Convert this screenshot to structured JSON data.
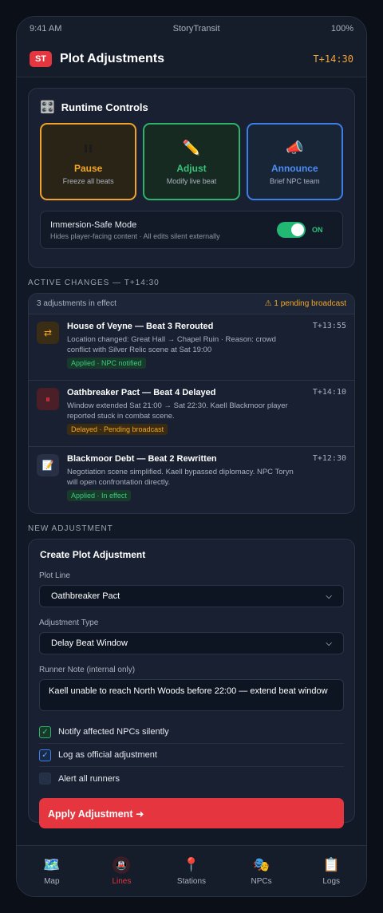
{
  "status": {
    "time": "9:41 AM",
    "carrier": "StoryTransit",
    "battery": "100%"
  },
  "app": {
    "logo": "ST",
    "title": "Plot Adjustments",
    "clock": "T+14:30"
  },
  "runtime": {
    "title": "Runtime Controls",
    "icon": "🎛️",
    "controls": [
      {
        "label": "Pause",
        "sub": "Freeze all beats",
        "color": "#f5a623"
      },
      {
        "label": "Adjust",
        "sub": "Modify live beat",
        "icon": "✏️",
        "color": "#39c27a"
      },
      {
        "label": "Announce",
        "sub": "Brief NPC team",
        "icon": "📣",
        "color": "#4d8ef5"
      }
    ],
    "immersion": {
      "title": "Immersion-Safe Mode",
      "sub": "Hides player-facing content · All edits silent externally",
      "state": "ON",
      "enabled": true
    }
  },
  "active": {
    "section_label": "ACTIVE CHANGES — T+14:30",
    "summary": "3 adjustments in effect",
    "pending": "⚠ 1 pending broadcast",
    "items": [
      {
        "icon": "⇄",
        "title": "House of Veyne — Beat 3 Rerouted",
        "time": "T+13:55",
        "desc": "Location changed: Great Hall → Chapel Ruin · Reason: crowd conflict with Silver Relic scene at Sat 19:00",
        "badge": "Applied · NPC notified"
      },
      {
        "icon": "⏸",
        "title": "Oathbreaker Pact — Beat 4 Delayed",
        "time": "T+14:10",
        "desc": "Window extended Sat 21:00 → Sat 22:30. Kaell Blackmoor player reported stuck in combat scene.",
        "badge": "Delayed · Pending broadcast"
      },
      {
        "icon": "📝",
        "title": "Blackmoor Debt — Beat 2 Rewritten",
        "time": "T+12:30",
        "desc": "Negotiation scene simplified. Kaell bypassed diplomacy. NPC Toryn will open confrontation directly.",
        "badge": "Applied · In effect"
      }
    ]
  },
  "form": {
    "section_label": "NEW ADJUSTMENT",
    "title": "Create Plot Adjustment",
    "plot_line_label": "Plot Line",
    "plot_line_value": "Oathbreaker Pact",
    "type_label": "Adjustment Type",
    "type_value": "Delay Beat Window",
    "note_label": "Runner Note (internal only)",
    "note_value": "Kaell unable to reach North Woods before 22:00 — extend beat window",
    "checks": [
      {
        "label": "Notify affected NPCs silently",
        "checked": true
      },
      {
        "label": "Log as official adjustment",
        "checked": true
      },
      {
        "label": "Alert all runners",
        "checked": false
      }
    ],
    "submit": "Apply Adjustment ➜"
  },
  "tabs": [
    {
      "label": "Map",
      "icon": "🗺️"
    },
    {
      "label": "Lines",
      "icon": "🚇",
      "active": true
    },
    {
      "label": "Stations",
      "icon": "📍"
    },
    {
      "label": "NPCs",
      "icon": "🎭"
    },
    {
      "label": "Logs",
      "icon": "📋"
    }
  ]
}
